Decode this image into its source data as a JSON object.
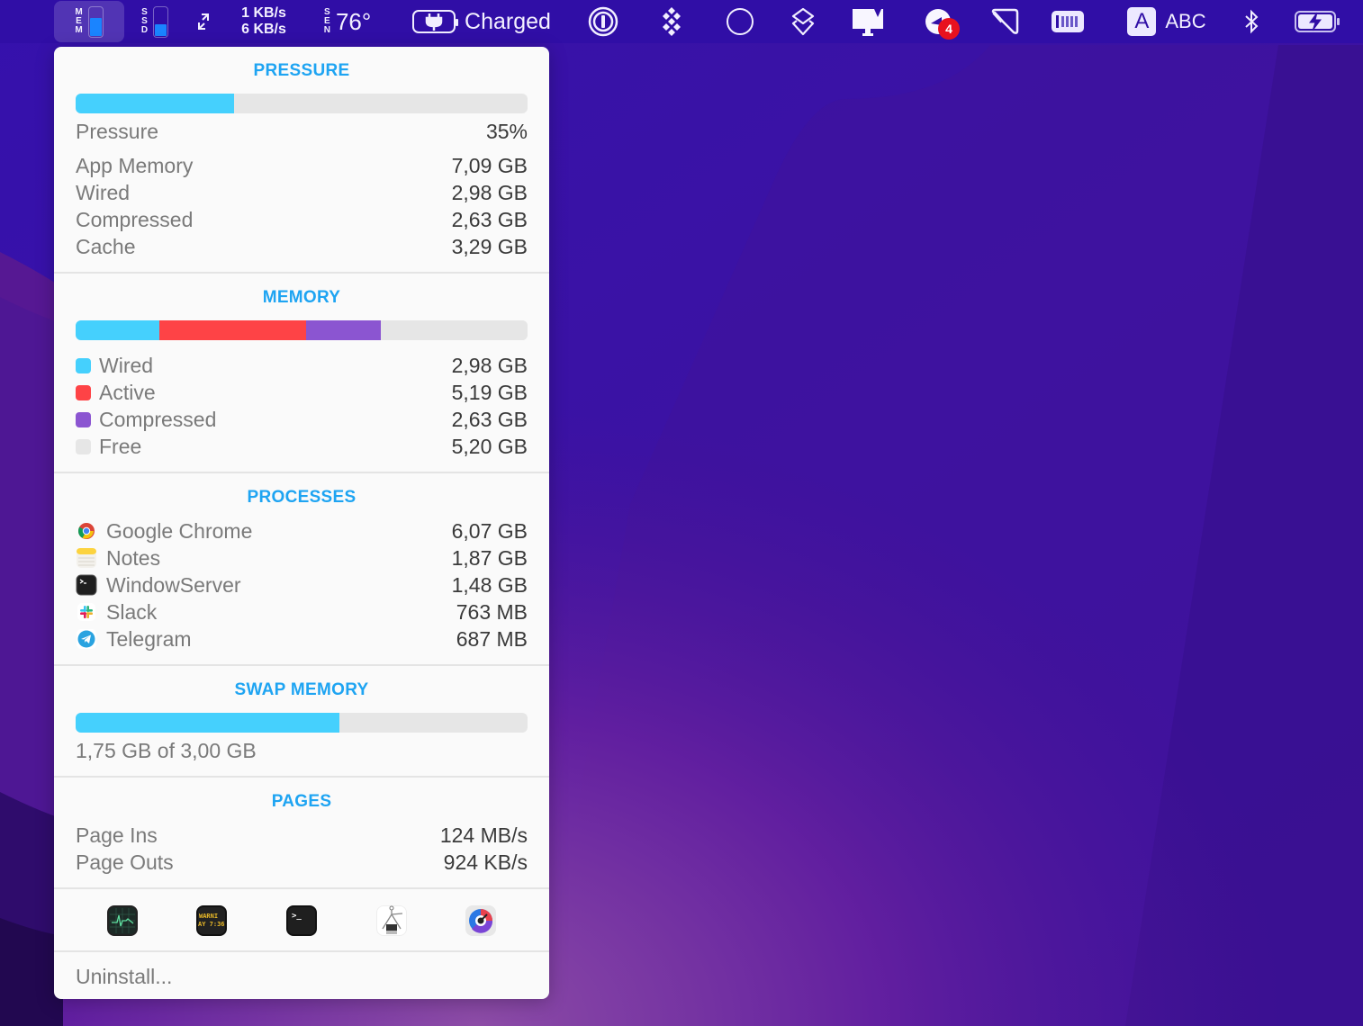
{
  "menubar": {
    "mem": {
      "label_letters": [
        "M",
        "E",
        "M"
      ],
      "fill_fraction": 0.58
    },
    "ssd": {
      "label_letters": [
        "S",
        "S",
        "D"
      ],
      "fill_fraction": 0.37
    },
    "network": {
      "upload": "1 KB/s",
      "download": "6 KB/s",
      "arrows_icon": "⇵"
    },
    "sensors": {
      "label_letters": [
        "S",
        "E",
        "N"
      ],
      "temperature": "76°"
    },
    "power": {
      "status": "Charged"
    },
    "notification_badge": "4",
    "input_source": {
      "letter": "A",
      "label": "ABC"
    },
    "icons": [
      "1password-icon",
      "diamond-grid-icon",
      "circle-icon",
      "stack-icon",
      "display-icon",
      "notification-icon",
      "tag-icon",
      "battery-bars-icon",
      "bluetooth-icon",
      "battery-charging-icon"
    ]
  },
  "popup": {
    "pressure": {
      "title": "PRESSURE",
      "percent": 35,
      "label": "Pressure",
      "value": "35%",
      "color": "#45d0fd",
      "rows": [
        {
          "label": "App Memory",
          "value": "7,09 GB"
        },
        {
          "label": "Wired",
          "value": "2,98 GB"
        },
        {
          "label": "Compressed",
          "value": "2,63 GB"
        },
        {
          "label": "Cache",
          "value": "3,29 GB"
        }
      ]
    },
    "memory": {
      "title": "MEMORY",
      "rows": [
        {
          "label": "Wired",
          "value": "2,98 GB",
          "gb": 2.98,
          "color": "#45d0fd"
        },
        {
          "label": "Active",
          "value": "5,19 GB",
          "gb": 5.19,
          "color": "#fe4346"
        },
        {
          "label": "Compressed",
          "value": "2,63 GB",
          "gb": 2.63,
          "color": "#8b55d1"
        },
        {
          "label": "Free",
          "value": "5,20 GB",
          "gb": 5.2,
          "color": "#e6e6e6"
        }
      ]
    },
    "processes": {
      "title": "PROCESSES",
      "rows": [
        {
          "name": "Google Chrome",
          "value": "6,07 GB",
          "icon": "chrome-icon"
        },
        {
          "name": "Notes",
          "value": "1,87 GB",
          "icon": "notes-icon"
        },
        {
          "name": "WindowServer",
          "value": "1,48 GB",
          "icon": "terminal-icon"
        },
        {
          "name": "Slack",
          "value": "763 MB",
          "icon": "slack-icon"
        },
        {
          "name": "Telegram",
          "value": "687 MB",
          "icon": "telegram-icon"
        }
      ]
    },
    "swap": {
      "title": "SWAP MEMORY",
      "used_gb": 1.75,
      "total_gb": 3.0,
      "text": "1,75 GB of 3,00 GB",
      "color": "#45d0fd"
    },
    "pages": {
      "title": "PAGES",
      "rows": [
        {
          "label": "Page Ins",
          "value": "124 MB/s"
        },
        {
          "label": "Page Outs",
          "value": "924 KB/s"
        }
      ]
    },
    "toolbar": {
      "apps": [
        {
          "name": "activity-monitor-icon"
        },
        {
          "name": "console-icon",
          "text_line1": "WARNI",
          "text_line2": "AY 7:36"
        },
        {
          "name": "terminal-icon",
          "prompt": ">_"
        },
        {
          "name": "system-information-icon"
        },
        {
          "name": "istat-menus-icon"
        }
      ]
    },
    "uninstall_label": "Uninstall..."
  }
}
